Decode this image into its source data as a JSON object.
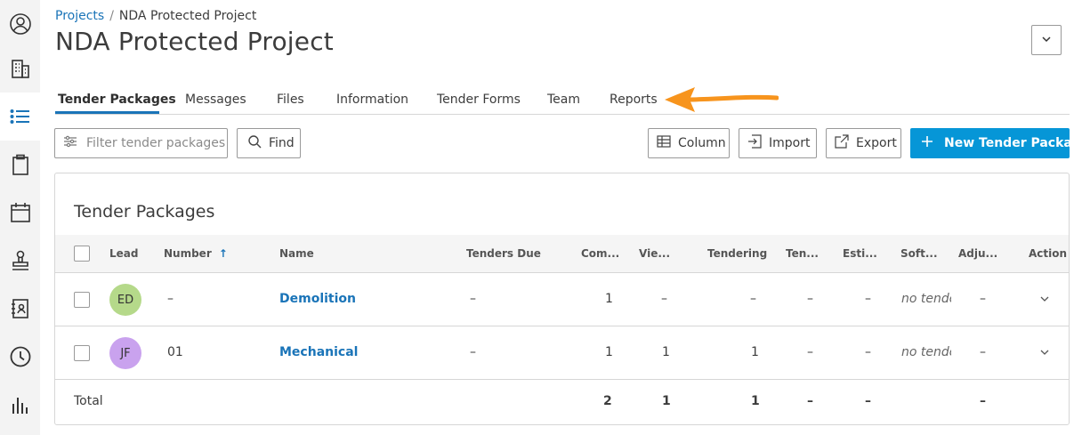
{
  "sidebar": {
    "items": [
      "user-icon",
      "building-icon",
      "list-icon",
      "clipboard-icon",
      "calendar-icon",
      "stamp-icon",
      "address-book-icon",
      "clock-icon",
      "chart-icon"
    ],
    "active_index": 2
  },
  "breadcrumb": {
    "root": "Projects",
    "separator": "/",
    "current": "NDA Protected Project"
  },
  "page": {
    "title": "NDA Protected Project"
  },
  "tabs": [
    {
      "label": "Tender Packages",
      "active": true
    },
    {
      "label": "Messages"
    },
    {
      "label": "Files"
    },
    {
      "label": "Information"
    },
    {
      "label": "Tender Forms"
    },
    {
      "label": "Team"
    },
    {
      "label": "Reports"
    }
  ],
  "toolbar": {
    "filter_placeholder": "Filter tender packages",
    "find_label": "Find",
    "column_label": "Column",
    "import_label": "Import",
    "export_label": "Export",
    "new_label": "New Tender Package"
  },
  "panel": {
    "title": "Tender Packages"
  },
  "table": {
    "headers": [
      "Lead",
      "Number",
      "Name",
      "Tenders Due",
      "Com...",
      "Vie...",
      "Tendering",
      "Ten...",
      "Esti...",
      "Soft...",
      "Adju...",
      "Action"
    ],
    "sort_indicator": "↑",
    "rows": [
      {
        "lead": "ED",
        "lead_color": "#b5d98a",
        "number": "–",
        "name": "Demolition",
        "tenders_due": "–",
        "com": "1",
        "vie": "–",
        "tendering": "–",
        "ten": "–",
        "esti": "–",
        "soft": "no tenders",
        "adju": "–"
      },
      {
        "lead": "JF",
        "lead_color": "#c9a2ee",
        "number": "01",
        "name": "Mechanical",
        "tenders_due": "–",
        "com": "1",
        "vie": "1",
        "tendering": "1",
        "ten": "–",
        "esti": "–",
        "soft": "no tenders",
        "adju": "–"
      }
    ],
    "total": {
      "label": "Total",
      "com": "2",
      "vie": "1",
      "tendering": "1",
      "ten": "–",
      "esti": "–",
      "adju": "–"
    }
  },
  "colors": {
    "accent": "#0696d7",
    "link": "#1a74b8",
    "arrow": "#f7941d"
  }
}
